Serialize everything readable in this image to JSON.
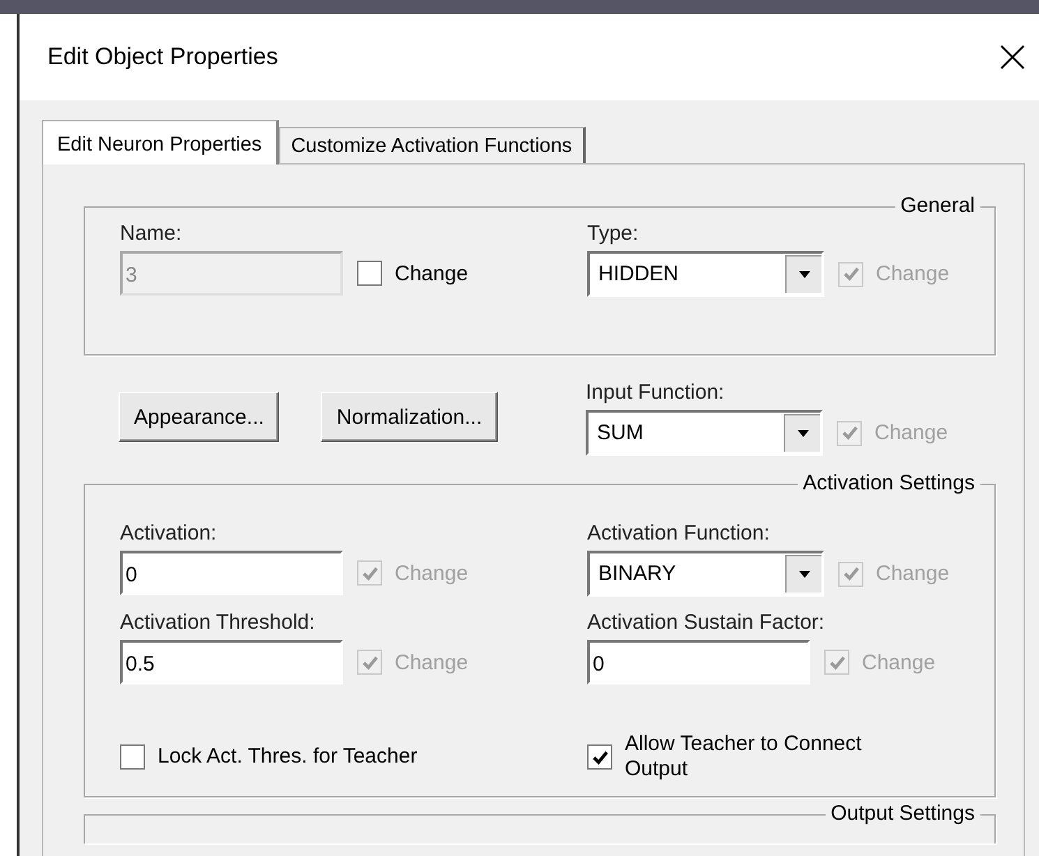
{
  "window": {
    "title": "Edit Object Properties"
  },
  "tabs": [
    {
      "label": "Edit Neuron Properties",
      "selected": true
    },
    {
      "label": "Customize Activation Functions",
      "selected": false
    }
  ],
  "general": {
    "legend": "General",
    "fields": [
      {
        "kind": "text",
        "label": "Name:",
        "value": "3",
        "disabled": true,
        "change": {
          "label": "Change",
          "checked": false,
          "disabled": false
        }
      },
      {
        "kind": "select",
        "label": "Type:",
        "value": "HIDDEN",
        "change": {
          "label": "Change",
          "checked": true,
          "disabled": true
        }
      }
    ]
  },
  "buttons": [
    "Appearance...",
    "Normalization..."
  ],
  "input_function": {
    "kind": "select",
    "label": "Input Function:",
    "value": "SUM",
    "change": {
      "label": "Change",
      "checked": true,
      "disabled": true
    }
  },
  "activation": {
    "legend": "Activation Settings",
    "fields": [
      {
        "kind": "text",
        "label": "Activation:",
        "value": "0",
        "disabled": false,
        "change": {
          "label": "Change",
          "checked": true,
          "disabled": true
        }
      },
      {
        "kind": "select",
        "label": "Activation Function:",
        "value": "BINARY",
        "change": {
          "label": "Change",
          "checked": true,
          "disabled": true
        }
      },
      {
        "kind": "text",
        "label": "Activation Threshold:",
        "value": "0.5",
        "disabled": false,
        "change": {
          "label": "Change",
          "checked": true,
          "disabled": true
        }
      },
      {
        "kind": "text",
        "label": "Activation Sustain Factor:",
        "value": "0",
        "disabled": false,
        "change": {
          "label": "Change",
          "checked": true,
          "disabled": true
        }
      }
    ],
    "options": [
      {
        "label": "Lock Act. Thres. for Teacher",
        "checked": false
      },
      {
        "label": "Allow Teacher to Connect Output",
        "checked": true
      }
    ]
  },
  "output": {
    "legend": "Output Settings"
  }
}
